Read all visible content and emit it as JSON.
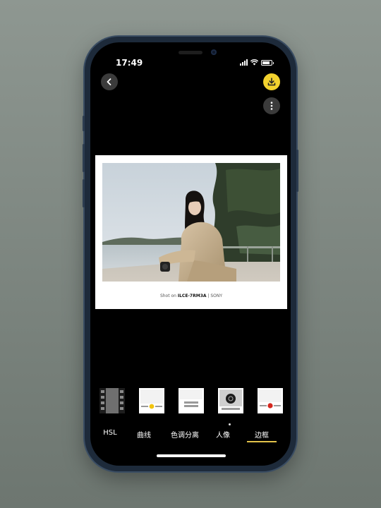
{
  "status_bar": {
    "time": "17:49",
    "battery_level": 0.8
  },
  "toolbar": {
    "back_icon": "chevron-left-icon",
    "download_icon": "download-icon",
    "more_icon": "more-vertical-icon",
    "accent_color": "#f2d22e"
  },
  "preview": {
    "caption_prefix": "Shot on ",
    "camera_model": "ILCE-7RM3A",
    "brand": "SONY"
  },
  "frame_styles": [
    {
      "name": "film-frame"
    },
    {
      "name": "bottom-bar-fujifilm-logo"
    },
    {
      "name": "bottom-bar-two-lines"
    },
    {
      "name": "bottom-bar-circle-logo",
      "selected": true
    },
    {
      "name": "bottom-bar-red-logo"
    }
  ],
  "tabs": [
    {
      "label": "HSL"
    },
    {
      "label": "曲线"
    },
    {
      "label": "色调分离"
    },
    {
      "label": "人像"
    },
    {
      "label": "边框",
      "active": true
    }
  ],
  "tabs_active_color": "#e2c24a"
}
